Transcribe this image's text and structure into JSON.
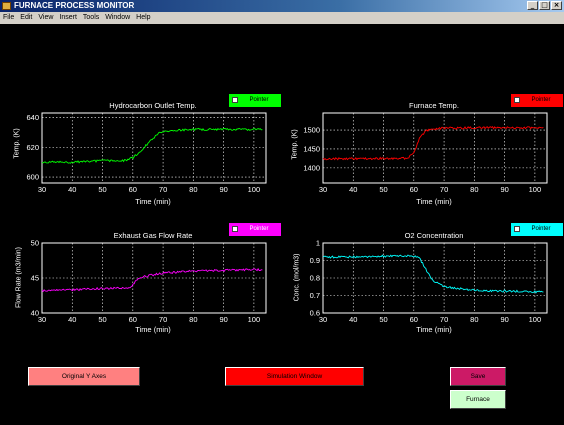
{
  "window": {
    "title": "FURNACE PROCESS MONITOR"
  },
  "menu": [
    "File",
    "Edit",
    "View",
    "Insert",
    "Tools",
    "Window",
    "Help"
  ],
  "colors": {
    "green": "#00ff00",
    "red": "#ff0000",
    "magenta": "#ff00ff",
    "cyan": "#00ffff"
  },
  "plots": {
    "p1": {
      "title": "Hydrocarbon Outlet Temp.",
      "ylabel": "Temp. (K)",
      "xlabel": "Time (min)",
      "pointer": "Pointer"
    },
    "p2": {
      "title": "Furnace Temp.",
      "ylabel": "Temp. (K)",
      "xlabel": "Time (min)",
      "pointer": "Pointer"
    },
    "p3": {
      "title": "Exhaust Gas Flow Rate",
      "ylabel": "Flow Rate (m3/min)",
      "xlabel": "Time (min)",
      "pointer": "Pointer"
    },
    "p4": {
      "title": "O2 Concentration",
      "ylabel": "Conc. (mol/m3)",
      "xlabel": "Time (min)",
      "pointer": "Pointer"
    }
  },
  "buttons": {
    "original_y": "Original Y Axes",
    "simulation": "Simulation Window",
    "save": "Save",
    "furnace": "Furnace"
  },
  "chart_data": [
    {
      "type": "line",
      "title": "Hydrocarbon Outlet Temp.",
      "xlabel": "Time (min)",
      "ylabel": "Temp. (K)",
      "xlim": [
        30,
        104
      ],
      "ylim": [
        596,
        643
      ],
      "xticks": [
        30,
        40,
        50,
        60,
        70,
        80,
        90,
        100
      ],
      "yticks": [
        600,
        620,
        640
      ],
      "grid": true,
      "series": [
        {
          "color": "#00ff00",
          "x": [
            30,
            40,
            50,
            57,
            60,
            63,
            66,
            69,
            72,
            80,
            90,
            103
          ],
          "y": [
            610,
            610,
            611,
            611,
            613,
            618,
            625,
            630,
            631,
            632,
            632,
            632
          ]
        }
      ]
    },
    {
      "type": "line",
      "title": "Furnace Temp.",
      "xlabel": "Time (min)",
      "ylabel": "Temp. (K)",
      "xlim": [
        30,
        104
      ],
      "ylim": [
        1360,
        1545
      ],
      "xticks": [
        30,
        40,
        50,
        60,
        70,
        80,
        90,
        100
      ],
      "yticks": [
        1400,
        1450,
        1500
      ],
      "grid": true,
      "series": [
        {
          "color": "#ff0000",
          "x": [
            30,
            40,
            50,
            58,
            60,
            62,
            64,
            66,
            70,
            80,
            90,
            103
          ],
          "y": [
            1424,
            1424,
            1425,
            1425,
            1440,
            1480,
            1498,
            1503,
            1505,
            1506,
            1506,
            1506
          ]
        }
      ]
    },
    {
      "type": "line",
      "title": "Exhaust Gas Flow Rate",
      "xlabel": "Time (min)",
      "ylabel": "Flow Rate (m3/min)",
      "xlim": [
        30,
        104
      ],
      "ylim": [
        40,
        50
      ],
      "xticks": [
        30,
        40,
        50,
        60,
        70,
        80,
        90,
        100
      ],
      "yticks": [
        40,
        45,
        50
      ],
      "grid": true,
      "series": [
        {
          "color": "#ff00ff",
          "x": [
            30,
            40,
            50,
            59,
            61,
            63,
            66,
            70,
            80,
            90,
            103
          ],
          "y": [
            43.2,
            43.3,
            43.5,
            43.6,
            44.6,
            45.1,
            45.4,
            45.7,
            46.0,
            46.1,
            46.2
          ]
        }
      ]
    },
    {
      "type": "line",
      "title": "O2 Concentration",
      "xlabel": "Time (min)",
      "ylabel": "Conc. (mol/m3)",
      "xlim": [
        30,
        104
      ],
      "ylim": [
        0.6,
        1.0
      ],
      "xticks": [
        30,
        40,
        50,
        60,
        70,
        80,
        90,
        100
      ],
      "yticks": [
        0.6,
        0.7,
        0.8,
        0.9,
        1
      ],
      "grid": true,
      "series": [
        {
          "color": "#00ffff",
          "x": [
            30,
            40,
            50,
            60,
            62,
            64,
            66,
            68,
            70,
            75,
            80,
            90,
            103
          ],
          "y": [
            0.92,
            0.92,
            0.925,
            0.925,
            0.91,
            0.85,
            0.79,
            0.77,
            0.75,
            0.74,
            0.73,
            0.725,
            0.72
          ]
        }
      ]
    }
  ]
}
